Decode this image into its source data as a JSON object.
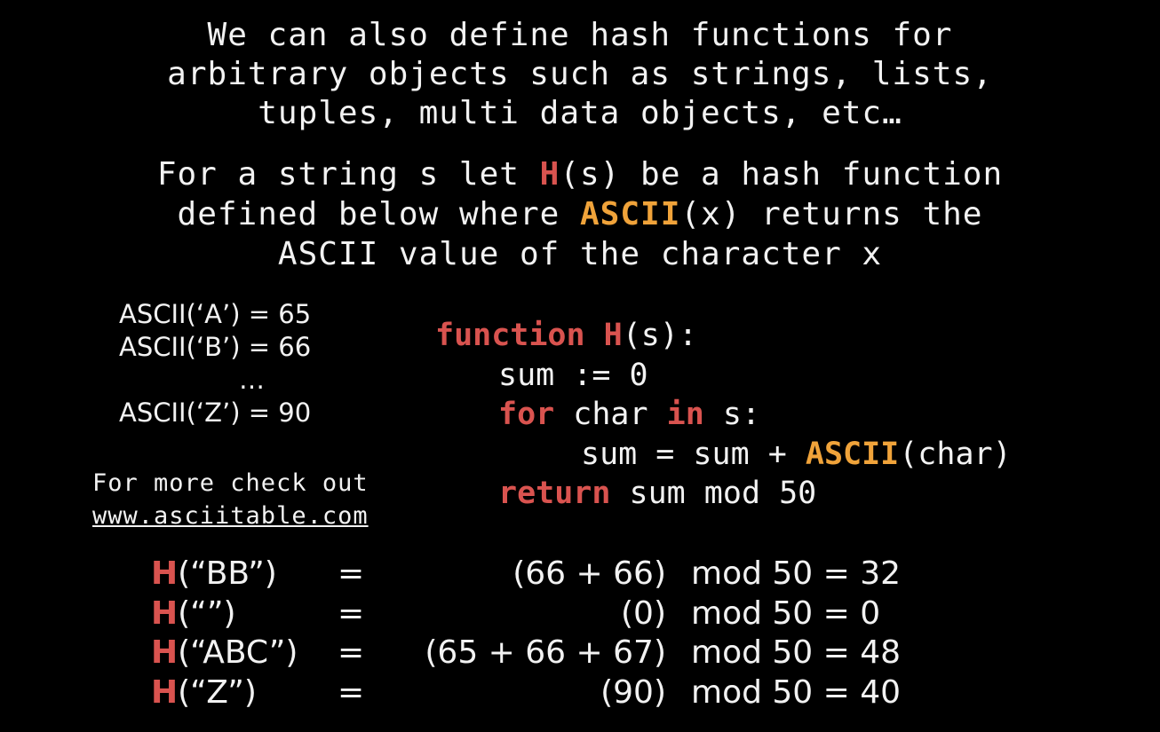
{
  "intro": {
    "line1": "We can also define hash functions for",
    "line2": "arbitrary objects such as strings, lists,",
    "line3": "tuples, multi data objects, etc…"
  },
  "definition": {
    "l1_pre": "For a string s let ",
    "l1_fn": "H",
    "l1_post": "(s) be a hash function",
    "l2_pre": "defined below where ",
    "l2_fn": "ASCII",
    "l2_post": "(x) returns the",
    "l3": "ASCII value of the character x"
  },
  "ascii_table": {
    "rows": [
      "ASCII(‘A’) = 65",
      "ASCII(‘B’) = 66",
      "…",
      "ASCII(‘Z’) = 90"
    ]
  },
  "more_info": {
    "text": "For more check out",
    "link": "www.asciitable.com"
  },
  "code": {
    "kw_function": "function",
    "fn_name": "H",
    "sig_rest": "(s):",
    "line_sum_init": "sum := 0",
    "kw_for": "for",
    "for_var": " char ",
    "kw_in": "in",
    "for_rest": " s:",
    "sum_update_pre": "sum = sum + ",
    "ascii_fn": "ASCII",
    "sum_update_post": "(char)",
    "kw_return": "return",
    "return_rest": " sum mod 50"
  },
  "examples": [
    {
      "fn": "H",
      "arg": "(“BB”)",
      "eq": "=",
      "expr": "(66 + 66)",
      "result": "mod 50 = 32"
    },
    {
      "fn": "H",
      "arg": "(“”)",
      "eq": "=",
      "expr": "(0)",
      "result": "mod 50 = 0"
    },
    {
      "fn": "H",
      "arg": "(“ABC”)",
      "eq": "=",
      "expr": "(65 + 66 + 67)",
      "result": "mod 50 = 48"
    },
    {
      "fn": "H",
      "arg": "(“Z”)",
      "eq": "=",
      "expr": "(90)",
      "result": "mod 50 = 40"
    }
  ],
  "colors": {
    "background": "#000000",
    "text": "#f2f2f2",
    "keyword_red": "#d9534f",
    "function_orange": "#f0a33a"
  }
}
